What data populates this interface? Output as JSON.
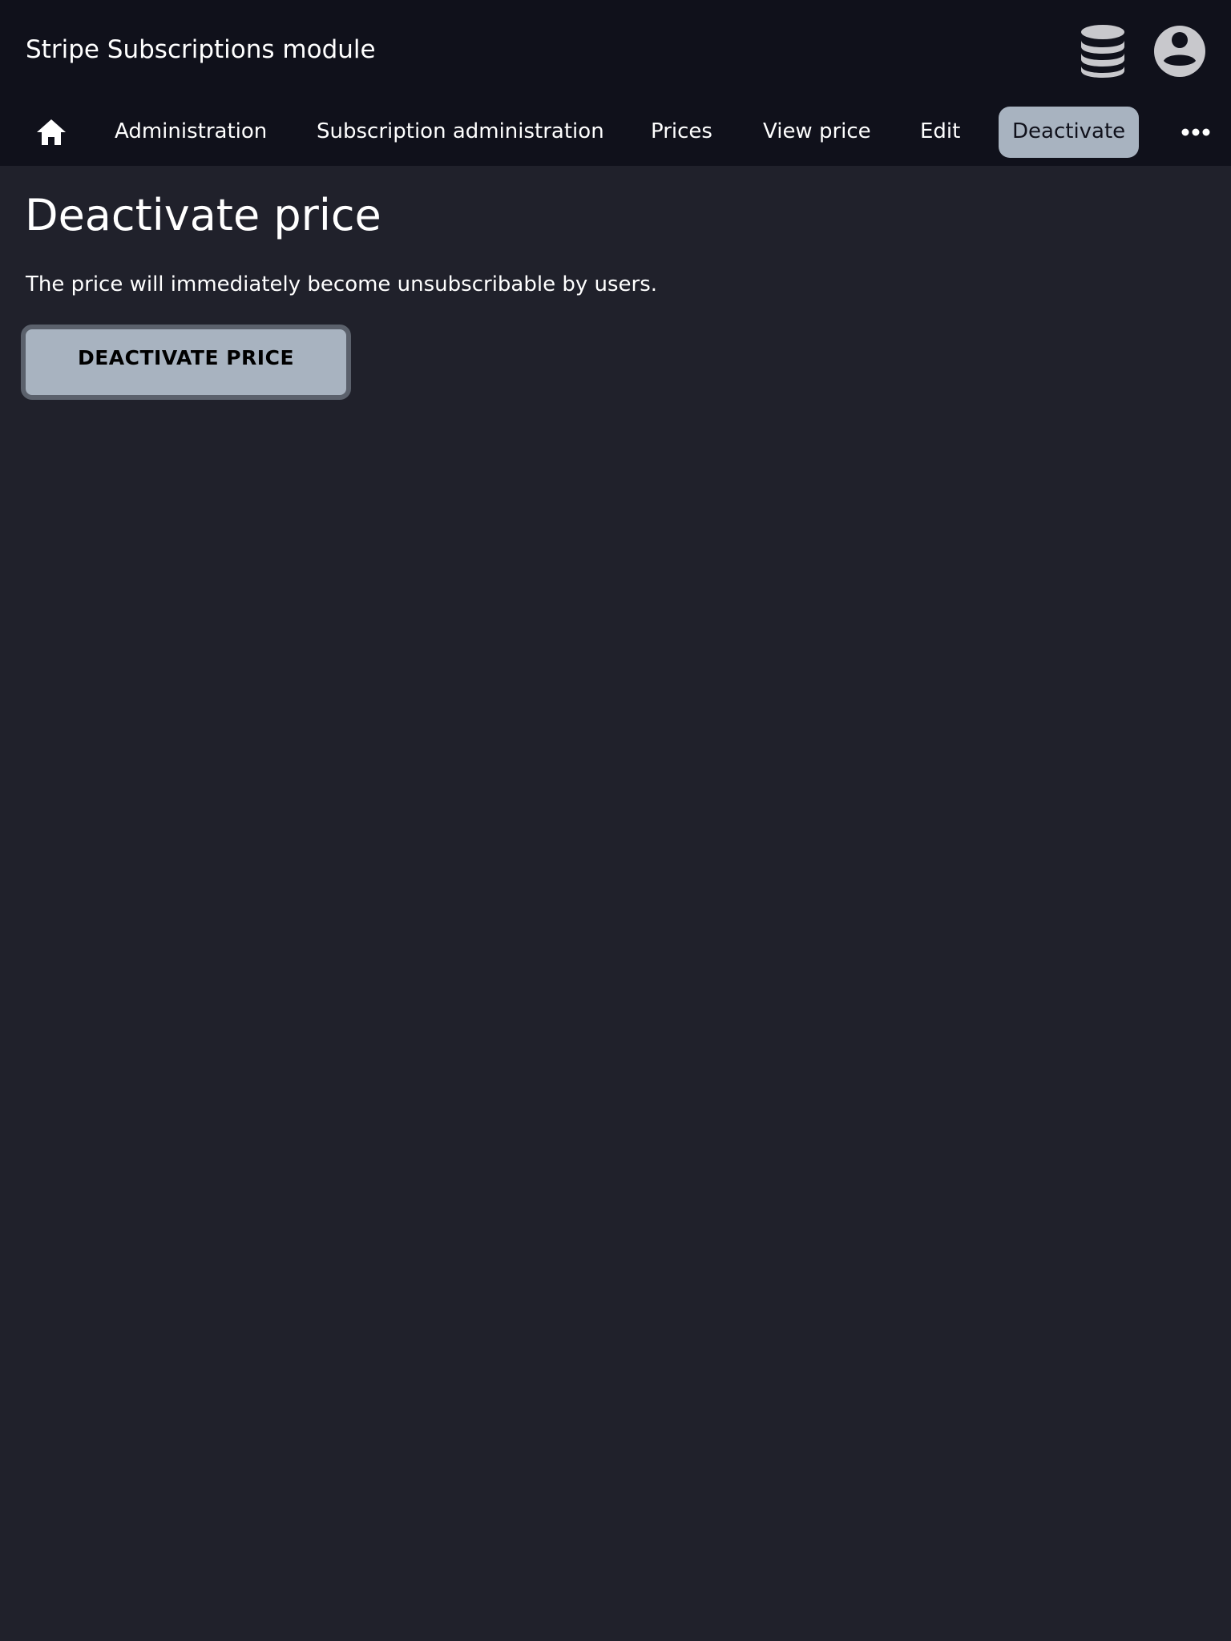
{
  "header": {
    "title": "Stripe Subscriptions module",
    "icons": [
      "database-icon",
      "user-account-icon"
    ]
  },
  "nav": {
    "home_icon": "home-icon",
    "items": [
      {
        "label": "Administration"
      },
      {
        "label": "Subscription administration"
      },
      {
        "label": "Prices"
      },
      {
        "label": "View price"
      },
      {
        "label": "Edit"
      },
      {
        "label": "Deactivate",
        "active": true
      }
    ],
    "more_icon": "more-horizontal-icon"
  },
  "main": {
    "title": "Deactivate price",
    "description": "The price will immediately become unsubscribable by users.",
    "button_label": "DEACTIVATE PRICE"
  },
  "colors": {
    "header_bg": "#10111b",
    "page_bg": "#20212b",
    "accent": "#a8b3c0",
    "button_border": "#5b616c",
    "icon_gray": "#c8c8cc"
  }
}
